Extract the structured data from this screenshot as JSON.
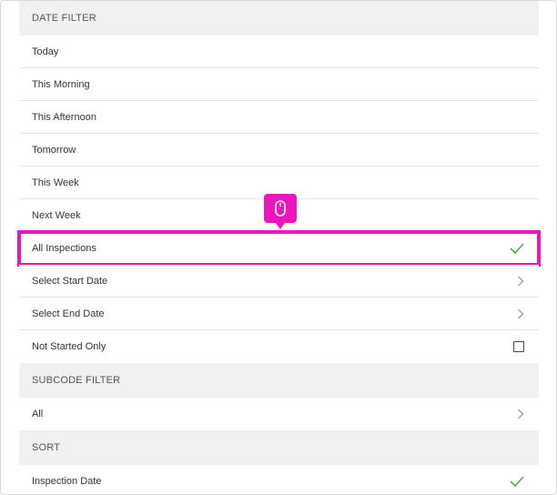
{
  "sections": {
    "date_filter": {
      "title": "DATE FILTER",
      "items": [
        {
          "label": "Today"
        },
        {
          "label": "This Morning"
        },
        {
          "label": "This Afternoon"
        },
        {
          "label": "Tomorrow"
        },
        {
          "label": "This Week"
        },
        {
          "label": "Next Week"
        },
        {
          "label": "All Inspections",
          "selected": true
        },
        {
          "label": "Select Start Date"
        },
        {
          "label": "Select End Date"
        },
        {
          "label": "Not Started Only",
          "checked": false
        }
      ]
    },
    "subcode_filter": {
      "title": "SUBCODE FILTER",
      "items": [
        {
          "label": "All"
        }
      ]
    },
    "sort": {
      "title": "SORT",
      "items": [
        {
          "label": "Inspection Date",
          "selected": true
        }
      ]
    }
  },
  "colors": {
    "highlight": "#ea15bd",
    "check": "#4caf50",
    "section_bg": "#f1f1f1"
  },
  "icons": {
    "selected": "checkmark-icon",
    "navigate": "chevron-right-icon",
    "toggle": "checkbox-icon",
    "cursor": "mouse-icon"
  }
}
